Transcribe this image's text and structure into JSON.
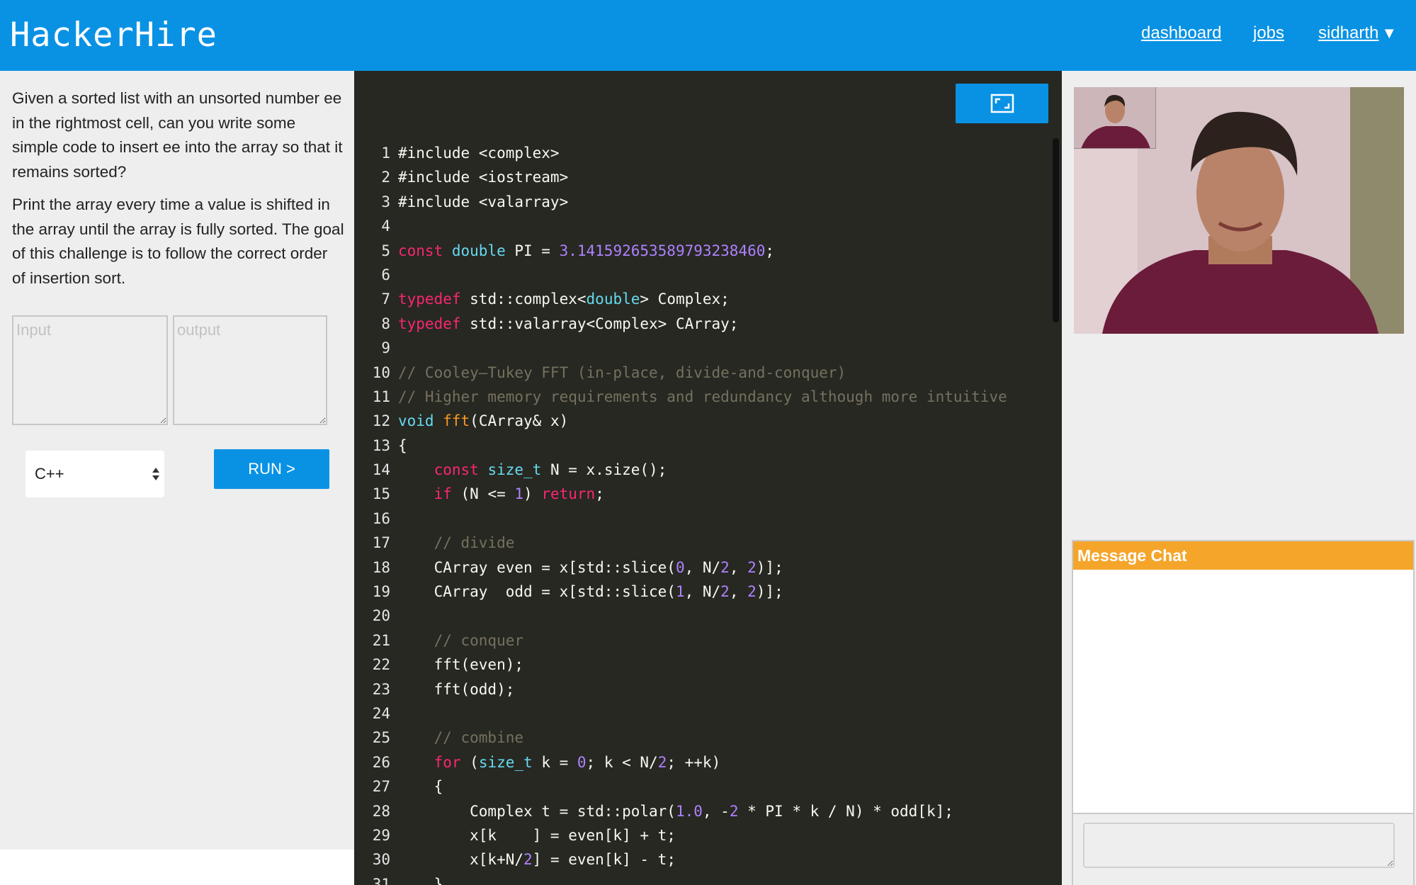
{
  "header": {
    "logo": "HackerHire",
    "nav": {
      "dashboard": "dashboard",
      "jobs": "jobs",
      "user": "sidharth"
    },
    "caret_icon": "triangle-down-icon"
  },
  "problem": {
    "paragraph1": "Given a sorted list with an unsorted number ee in the rightmost cell, can you write some simple code to insert ee into the array so that it remains sorted?",
    "paragraph2": "Print the array every time a value is shifted in the array until the array is fully sorted. The goal of this challenge is to follow the correct order of insertion sort."
  },
  "io": {
    "input_placeholder": "Input",
    "output_placeholder": "output"
  },
  "controls": {
    "language": "C++",
    "run_label": "RUN >"
  },
  "editor": {
    "expand_icon": "fullscreen-icon",
    "lines": [
      [
        [
          "",
          "#include <complex>"
        ]
      ],
      [
        [
          "",
          "#include <iostream>"
        ]
      ],
      [
        [
          "",
          "#include <valarray>"
        ]
      ],
      [],
      [
        [
          "kw",
          "const"
        ],
        [
          "",
          " "
        ],
        [
          "ty",
          "double"
        ],
        [
          "",
          " PI = "
        ],
        [
          "nu",
          "3.141592653589793238460"
        ],
        [
          "",
          ";"
        ]
      ],
      [],
      [
        [
          "kw",
          "typedef"
        ],
        [
          "",
          " std::complex<"
        ],
        [
          "ty",
          "double"
        ],
        [
          "",
          "> Complex;"
        ]
      ],
      [
        [
          "kw",
          "typedef"
        ],
        [
          "",
          " std::valarray<Complex> CArray;"
        ]
      ],
      [],
      [
        [
          "cm",
          "// Cooley–Tukey FFT (in-place, divide-and-conquer)"
        ]
      ],
      [
        [
          "cm",
          "// Higher memory requirements and redundancy although more intuitive"
        ]
      ],
      [
        [
          "ty",
          "void"
        ],
        [
          "",
          " "
        ],
        [
          "fn",
          "fft"
        ],
        [
          "",
          "(CArray& x)"
        ]
      ],
      [
        [
          "",
          "{"
        ]
      ],
      [
        [
          "",
          "    "
        ],
        [
          "kw",
          "const"
        ],
        [
          "",
          " "
        ],
        [
          "ty",
          "size_t"
        ],
        [
          "",
          " N = x.size();"
        ]
      ],
      [
        [
          "",
          "    "
        ],
        [
          "kw",
          "if"
        ],
        [
          "",
          " (N <= "
        ],
        [
          "nu",
          "1"
        ],
        [
          "",
          ") "
        ],
        [
          "kw",
          "return"
        ],
        [
          "",
          ";"
        ]
      ],
      [],
      [
        [
          "",
          "    "
        ],
        [
          "cm",
          "// divide"
        ]
      ],
      [
        [
          "",
          "    CArray even = x[std::slice("
        ],
        [
          "nu",
          "0"
        ],
        [
          "",
          ", N/"
        ],
        [
          "nu",
          "2"
        ],
        [
          "",
          ", "
        ],
        [
          "nu",
          "2"
        ],
        [
          "",
          ")];"
        ]
      ],
      [
        [
          "",
          "    CArray  odd = x[std::slice("
        ],
        [
          "nu",
          "1"
        ],
        [
          "",
          ", N/"
        ],
        [
          "nu",
          "2"
        ],
        [
          "",
          ", "
        ],
        [
          "nu",
          "2"
        ],
        [
          "",
          ")];"
        ]
      ],
      [],
      [
        [
          "",
          "    "
        ],
        [
          "cm",
          "// conquer"
        ]
      ],
      [
        [
          "",
          "    fft(even);"
        ]
      ],
      [
        [
          "",
          "    fft(odd);"
        ]
      ],
      [],
      [
        [
          "",
          "    "
        ],
        [
          "cm",
          "// combine"
        ]
      ],
      [
        [
          "",
          "    "
        ],
        [
          "kw",
          "for"
        ],
        [
          "",
          " ("
        ],
        [
          "ty",
          "size_t"
        ],
        [
          "",
          " k = "
        ],
        [
          "nu",
          "0"
        ],
        [
          "",
          "; k < N/"
        ],
        [
          "nu",
          "2"
        ],
        [
          "",
          "; ++k)"
        ]
      ],
      [
        [
          "",
          "    {"
        ]
      ],
      [
        [
          "",
          "        Complex t = std::polar("
        ],
        [
          "nu",
          "1.0"
        ],
        [
          "",
          ", -"
        ],
        [
          "nu",
          "2"
        ],
        [
          "",
          " * PI * k / N) * odd[k];"
        ]
      ],
      [
        [
          "",
          "        x[k    ] = even[k] + t;"
        ]
      ],
      [
        [
          "",
          "        x[k+N/"
        ],
        [
          "nu",
          "2"
        ],
        [
          "",
          "] = even[k] - t;"
        ]
      ],
      [
        [
          "",
          "    }"
        ]
      ]
    ]
  },
  "video": {
    "remote_label": "remote-video",
    "self_label": "self-video"
  },
  "chat": {
    "title": "Message Chat",
    "input_value": ""
  }
}
